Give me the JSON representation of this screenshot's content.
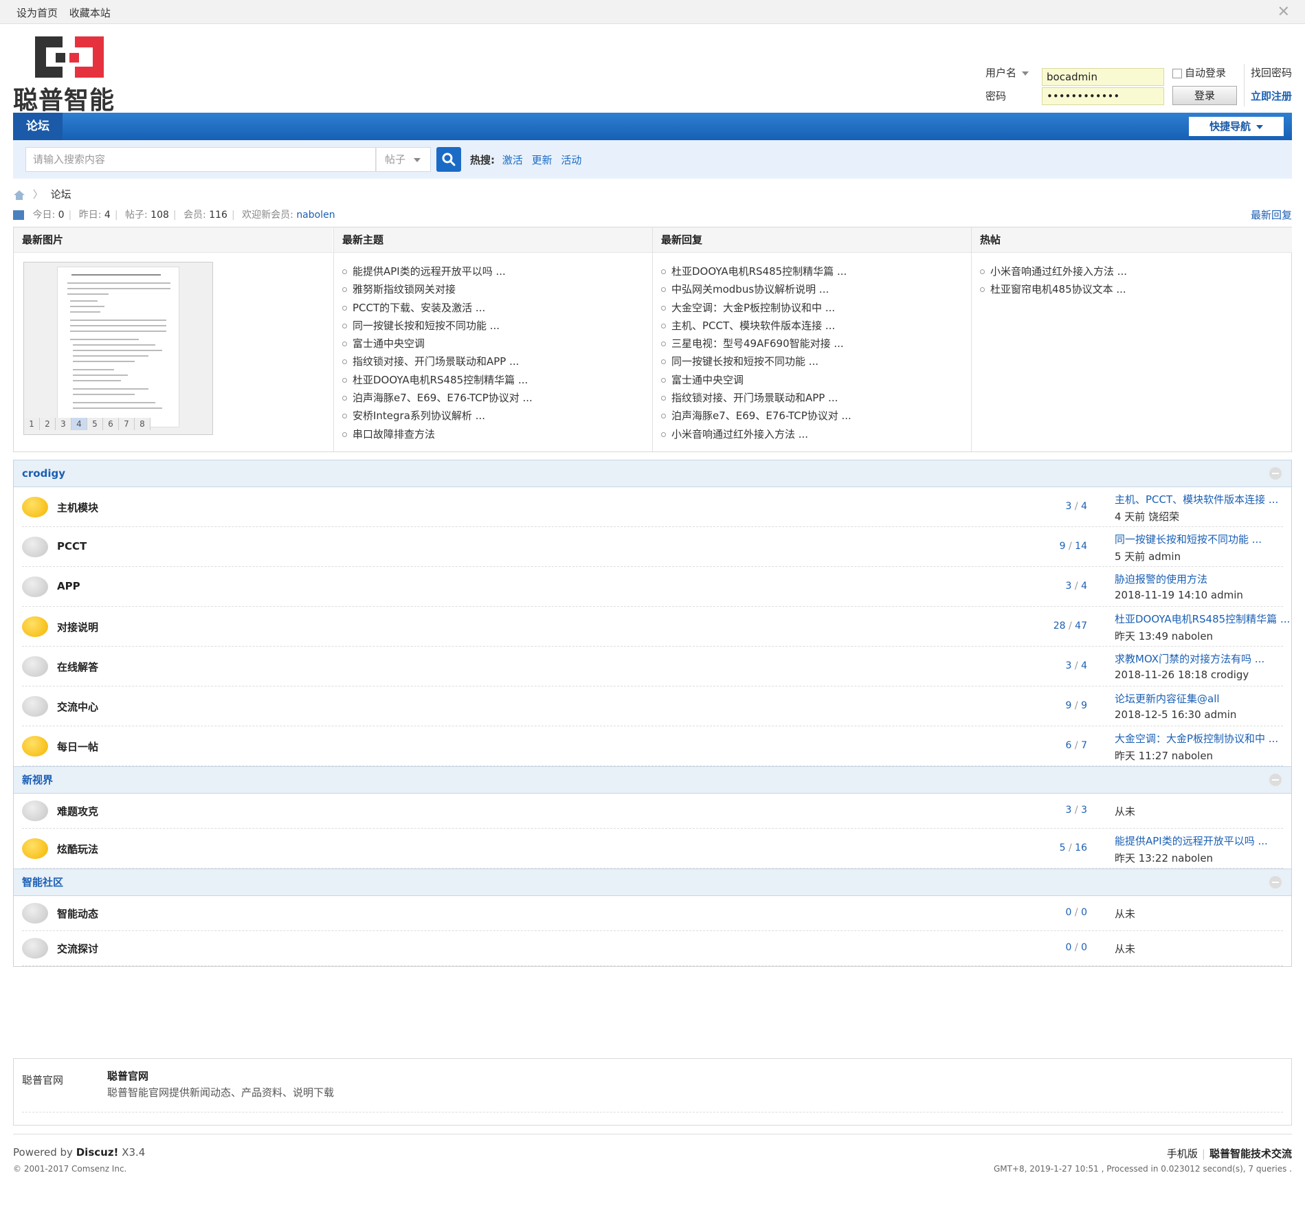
{
  "topbar": {
    "set_home": "设为首页",
    "bookmark": "收藏本站"
  },
  "logo": {
    "brand": "聪普智能"
  },
  "login": {
    "username_label": "用户名",
    "username_value": "bocadmin",
    "password_label": "密码",
    "password_value": "••••••••••••",
    "auto_login": "自动登录",
    "login_button": "登录",
    "find_password": "找回密码",
    "register": "立即注册"
  },
  "nav": {
    "forum_tab": "论坛",
    "quick_nav": "快捷导航"
  },
  "search": {
    "placeholder": "请输入搜索内容",
    "type": "帖子",
    "hot_label": "热搜:",
    "hot_keywords": [
      "激活",
      "更新",
      "活动"
    ]
  },
  "breadcrumb": {
    "current": "论坛"
  },
  "stats": {
    "today_label": "今日:",
    "today": "0",
    "yesterday_label": "昨日:",
    "yesterday": "4",
    "posts_label": "帖子:",
    "posts": "108",
    "members_label": "会员:",
    "members": "116",
    "welcome_label": "欢迎新会员:",
    "new_member": "nabolen",
    "latest_reply_link": "最新回复"
  },
  "portal": {
    "latest_images": {
      "title": "最新图片",
      "pager": [
        "1",
        "2",
        "3",
        "4",
        "5",
        "6",
        "7",
        "8"
      ]
    },
    "latest_threads": {
      "title": "最新主题",
      "items": [
        "能提供API类的远程开放平以吗 ...",
        "雅努斯指纹锁网关对接",
        "PCCT的下载、安装及激活 ...",
        "同一按键长按和短按不同功能 ...",
        "富士通中央空调",
        "指纹锁对接、开门场景联动和APP ...",
        "杜亚DOOYA电机RS485控制精华篇 ...",
        "泊声海豚e7、E69、E76-TCP协议对 ...",
        "安桥Integra系列协议解析 ...",
        "串口故障排查方法"
      ]
    },
    "latest_replies": {
      "title": "最新回复",
      "items": [
        "杜亚DOOYA电机RS485控制精华篇 ...",
        "中弘网关modbus协议解析说明 ...",
        "大金空调：大金P板控制协议和中 ...",
        "主机、PCCT、模块软件版本连接 ...",
        "三星电视：型号49AF690智能对接 ...",
        "同一按键长按和短按不同功能 ...",
        "富士通中央空调",
        "指纹锁对接、开门场景联动和APP ...",
        "泊声海豚e7、E69、E76-TCP协议对 ...",
        "小米音响通过红外接入方法 ..."
      ]
    },
    "hot_threads": {
      "title": "热帖",
      "items": [
        "小米音响通过红外接入方法 ...",
        "杜亚窗帘电机485协议文本 ..."
      ]
    }
  },
  "groups": [
    {
      "name": "crodigy",
      "forums": [
        {
          "name": "主机模块",
          "new": true,
          "threads": "3",
          "posts": "4",
          "last_title": "主机、PCCT、模块软件版本连接 ...",
          "last_meta": "4 天前 饶绍荣"
        },
        {
          "name": "PCCT",
          "new": false,
          "threads": "9",
          "posts": "14",
          "last_title": "同一按键长按和短按不同功能 ...",
          "last_meta": "5 天前 admin"
        },
        {
          "name": "APP",
          "new": false,
          "threads": "3",
          "posts": "4",
          "last_title": "胁迫报警的使用方法",
          "last_meta": "2018-11-19 14:10 admin"
        },
        {
          "name": "对接说明",
          "new": true,
          "threads": "28",
          "posts": "47",
          "last_title": "杜亚DOOYA电机RS485控制精华篇 ...",
          "last_meta": "昨天 13:49 nabolen"
        },
        {
          "name": "在线解答",
          "new": false,
          "threads": "3",
          "posts": "4",
          "last_title": "求教MOX门禁的对接方法有吗 ...",
          "last_meta": "2018-11-26 18:18 crodigy"
        },
        {
          "name": "交流中心",
          "new": false,
          "threads": "9",
          "posts": "9",
          "last_title": "论坛更新内容征集@all",
          "last_meta": "2018-12-5 16:30 admin"
        },
        {
          "name": "每日一帖",
          "new": true,
          "threads": "6",
          "posts": "7",
          "last_title": "大金空调：大金P板控制协议和中 ...",
          "last_meta": "昨天 11:27 nabolen"
        }
      ]
    },
    {
      "name": "新视界",
      "forums": [
        {
          "name": "难题攻克",
          "new": false,
          "threads": "3",
          "posts": "3",
          "never": "从未"
        },
        {
          "name": "炫酷玩法",
          "new": true,
          "threads": "5",
          "posts": "16",
          "last_title": "能提供API类的远程开放平以吗 ...",
          "last_meta": "昨天 13:22 nabolen"
        }
      ]
    },
    {
      "name": "智能社区",
      "forums": [
        {
          "name": "智能动态",
          "new": false,
          "threads": "0",
          "posts": "0",
          "never": "从未"
        },
        {
          "name": "交流探讨",
          "new": false,
          "threads": "0",
          "posts": "0",
          "never": "从未"
        }
      ]
    }
  ],
  "friend_links": {
    "label": "聪普官网",
    "title": "聪普官网",
    "desc": "聪普智能官网提供新闻动态、产品资料、说明下载"
  },
  "footer": {
    "powered_prefix": "Powered by",
    "powered_brand": "Discuz!",
    "version": "X3.4",
    "copyright": "© 2001-2017 Comsenz Inc.",
    "mobile": "手机版",
    "site_name": "聪普智能技术交流",
    "server_info": "GMT+8, 2019-1-27 10:51 , Processed in 0.023012 second(s), 7 queries ."
  },
  "colors": {
    "nav_blue": "#1660b5",
    "link_blue": "#1a5fb4",
    "logo_red": "#e5323e",
    "logo_dark": "#333333"
  }
}
